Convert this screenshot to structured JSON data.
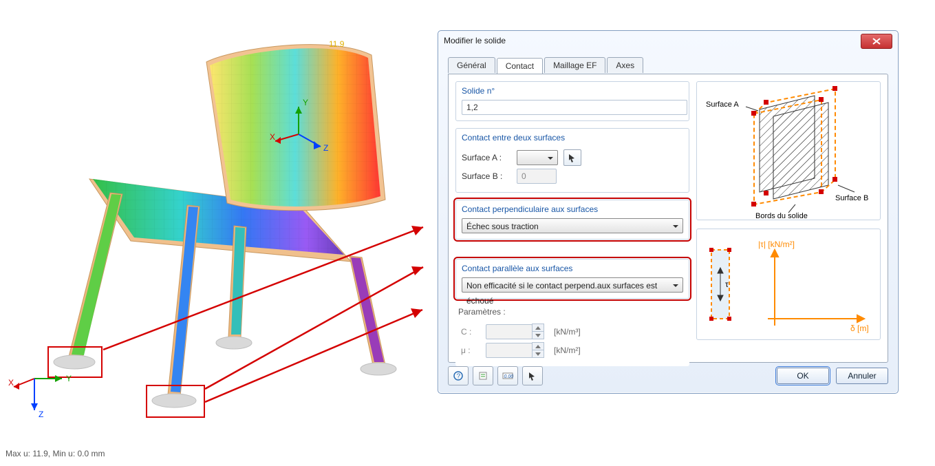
{
  "status": "Max u: 11.9, Min u: 0.0 mm",
  "topvalue": "11.9",
  "axes3d": {
    "x": "X",
    "y": "Y",
    "z": "Z"
  },
  "localaxes": {
    "x": "X",
    "y": "Y",
    "z": "Z"
  },
  "dialog": {
    "title": "Modifier le solide",
    "tabs": {
      "general": "Général",
      "contact": "Contact",
      "mesh": "Maillage EF",
      "axes": "Axes"
    },
    "solid": {
      "label": "Solide n°",
      "value": "1,2"
    },
    "surfaces": {
      "label": "Contact entre deux surfaces",
      "a": "Surface A :",
      "b": "Surface B :",
      "a_val": "",
      "b_val": "0"
    },
    "perp": {
      "label": "Contact perpendiculaire aux surfaces",
      "value": "Échec sous traction"
    },
    "para": {
      "label": "Contact parallèle aux surfaces",
      "value": "Non efficacité si le contact perpend.aux surfaces est échoué"
    },
    "params": {
      "label": "Paramètres :",
      "c": "C :",
      "mu": "μ :",
      "c_unit": "[kN/m³]",
      "mu_unit": "[kN/m²]",
      "c_val": "",
      "mu_val": ""
    },
    "diagA": {
      "surfA": "Surface A",
      "surfB": "Surface B",
      "edges": "Bords du solide"
    },
    "diagB": {
      "ylabel": "|τ| [kN/m²]",
      "xlabel": "δ [m]",
      "tau": "τ"
    },
    "buttons": {
      "ok": "OK",
      "cancel": "Annuler"
    }
  }
}
